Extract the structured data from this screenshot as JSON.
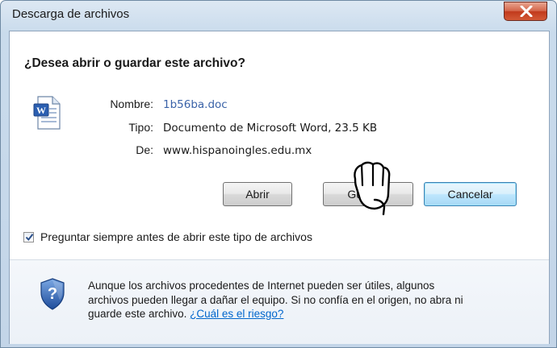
{
  "window": {
    "title": "Descarga de archivos"
  },
  "dialog": {
    "question": "¿Desea abrir o guardar este archivo?",
    "file": {
      "name_label": "Nombre:",
      "name_value": "1b56ba.doc",
      "type_label": "Tipo:",
      "type_value": "Documento de Microsoft Word, 23.5 KB",
      "from_label": "De:",
      "from_value": "www.hispanoingles.edu.mx",
      "icon": "word-document-icon"
    },
    "buttons": {
      "open": "Abrir",
      "save": "Guardar",
      "cancel": "Cancelar"
    },
    "checkbox": {
      "label": "Preguntar siempre antes de abrir este tipo de archivos",
      "checked": true
    },
    "warning": {
      "text": "Aunque los archivos procedentes de Internet pueden ser útiles, algunos archivos pueden llegar a dañar el equipo. Si no confía en el origen, no abra ni guarde este archivo. ",
      "link": "¿Cuál es el riesgo?",
      "icon": "shield-question-icon"
    }
  },
  "colors": {
    "title_bar": "#c9dbec",
    "close_button": "#c13a1c",
    "link": "#0066cc",
    "filename": "#3b63a8"
  }
}
